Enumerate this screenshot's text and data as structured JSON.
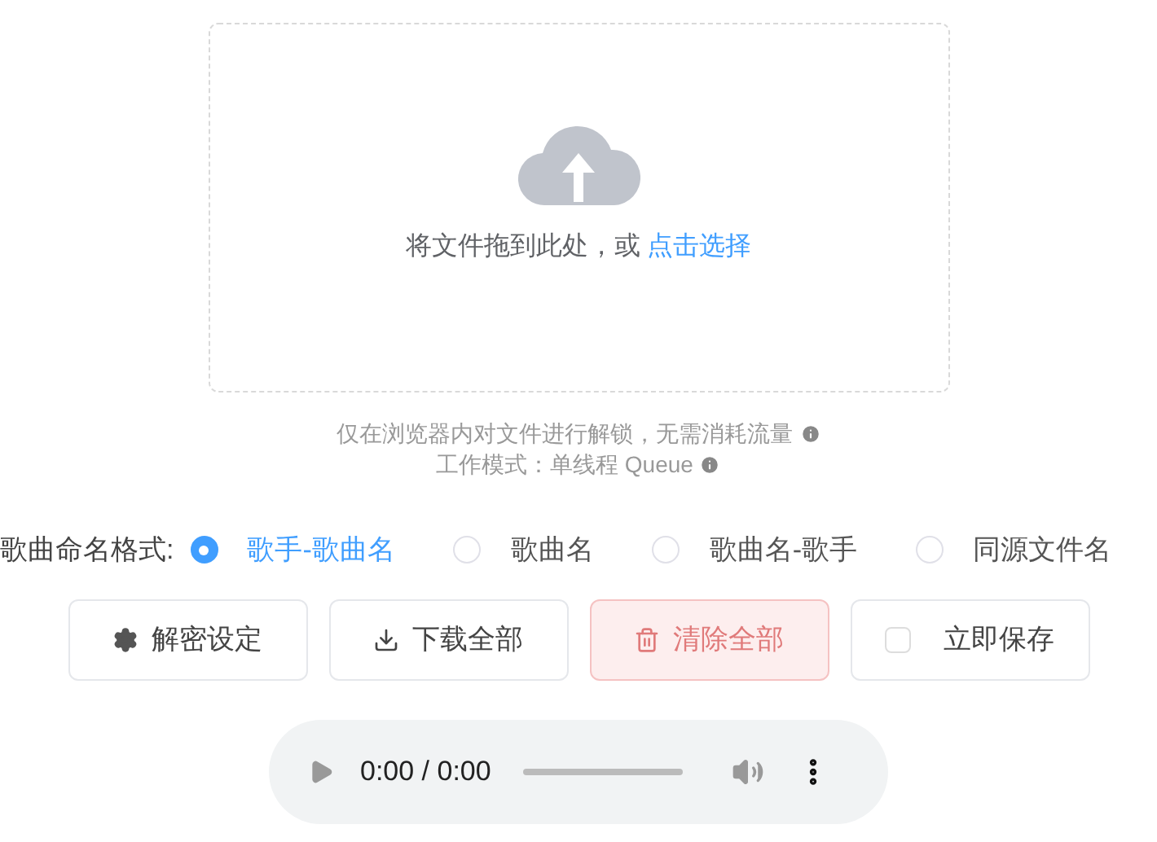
{
  "dropzone": {
    "prompt": "将文件拖到此处，或",
    "link": "点击选择"
  },
  "notes": [
    {
      "text": "仅在浏览器内对文件进行解锁，无需消耗流量"
    },
    {
      "text": "工作模式：单线程 Queue"
    }
  ],
  "naming": {
    "label": "歌曲命名格式:",
    "options": [
      {
        "label": "歌手-歌曲名",
        "selected": true
      },
      {
        "label": "歌曲名",
        "selected": false
      },
      {
        "label": "歌曲名-歌手",
        "selected": false
      },
      {
        "label": "同源文件名",
        "selected": false
      }
    ]
  },
  "buttons": [
    {
      "kind": "settings",
      "label": "解密设定"
    },
    {
      "kind": "download",
      "label": "下载全部"
    },
    {
      "kind": "clear",
      "label": "清除全部"
    },
    {
      "kind": "checkbox",
      "label": "立即保存",
      "checked": false
    }
  ],
  "player": {
    "time": "0:00 / 0:00"
  }
}
